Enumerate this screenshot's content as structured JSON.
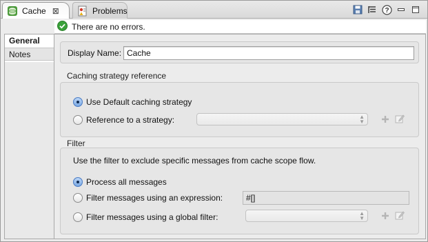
{
  "tabs": [
    {
      "label": "Cache",
      "close": "⊠",
      "icon": "database-icon"
    },
    {
      "label": "Problems",
      "icon": "problems-icon"
    }
  ],
  "toolbar": {
    "icons": [
      "save-icon",
      "outline-icon",
      "help-icon",
      "minimize-icon",
      "maximize-icon"
    ]
  },
  "status": {
    "text": "There are no errors.",
    "icon": "check-circle-icon"
  },
  "nav": {
    "items": [
      {
        "label": "General",
        "active": true
      },
      {
        "label": "Notes",
        "active": false
      }
    ]
  },
  "general": {
    "display_name_label": "Display Name:",
    "display_name_value": "Cache"
  },
  "caching": {
    "title": "Caching strategy reference",
    "option_default": "Use Default caching strategy",
    "option_reference": "Reference to a strategy:",
    "selected": "default"
  },
  "filter": {
    "title": "Filter",
    "description": "Use the filter to exclude specific messages from cache scope flow.",
    "option_all": "Process all messages",
    "option_expression": "Filter messages using an expression:",
    "expression_value": "#[]",
    "option_global": "Filter messages using a global filter:",
    "selected": "all"
  },
  "colors": {
    "accent": "#4a7bc4",
    "ok_green": "#3aa23a"
  }
}
